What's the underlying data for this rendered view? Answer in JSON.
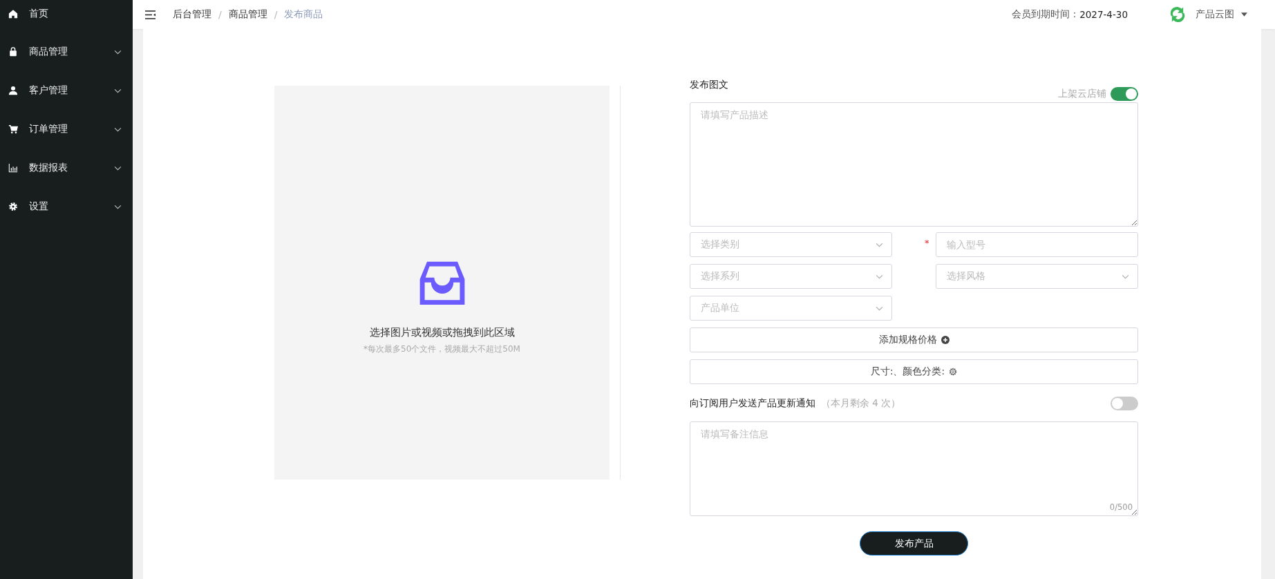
{
  "sidebar": {
    "items": [
      {
        "label": "首页",
        "expandable": false
      },
      {
        "label": "商品管理",
        "expandable": true
      },
      {
        "label": "客户管理",
        "expandable": true
      },
      {
        "label": "订单管理",
        "expandable": true
      },
      {
        "label": "数据报表",
        "expandable": true
      },
      {
        "label": "设置",
        "expandable": true
      }
    ]
  },
  "header": {
    "breadcrumb_separator": "/",
    "breadcrumb": [
      {
        "label": "后台管理",
        "current": false
      },
      {
        "label": "商品管理",
        "current": false
      },
      {
        "label": "发布商品",
        "current": true
      }
    ],
    "membership_label": "会员到期时间：",
    "membership_date": "2027-4-30",
    "account": "产品云图"
  },
  "upload": {
    "title": "选择图片或视频或拖拽到此区域",
    "hint": "*每次最多50个文件，视频最大不超过50M"
  },
  "form": {
    "title": "发布图文",
    "required_mark": "*",
    "shop_toggle": {
      "label": "上架云店铺",
      "on": true
    },
    "description": {
      "placeholder": "请填写产品描述"
    },
    "fields": [
      {
        "kind": "select",
        "placeholder": "选择类别",
        "required": false
      },
      {
        "kind": "input",
        "placeholder": "输入型号",
        "required": true
      },
      {
        "kind": "select",
        "placeholder": "选择系列",
        "required": false
      },
      {
        "kind": "select",
        "placeholder": "选择风格",
        "required": false
      },
      {
        "kind": "select",
        "placeholder": "产品单位",
        "required": false
      }
    ],
    "add_spec_button": "添加规格价格",
    "spec_button": "尺寸:、颜色分类:",
    "notify": {
      "label": "向订阅用户发送产品更新通知",
      "note": "（本月剩余 4 次）",
      "on": false
    },
    "remark": {
      "placeholder": "请填写备注信息",
      "counter": "0/500"
    },
    "submit": "发布产品"
  }
}
